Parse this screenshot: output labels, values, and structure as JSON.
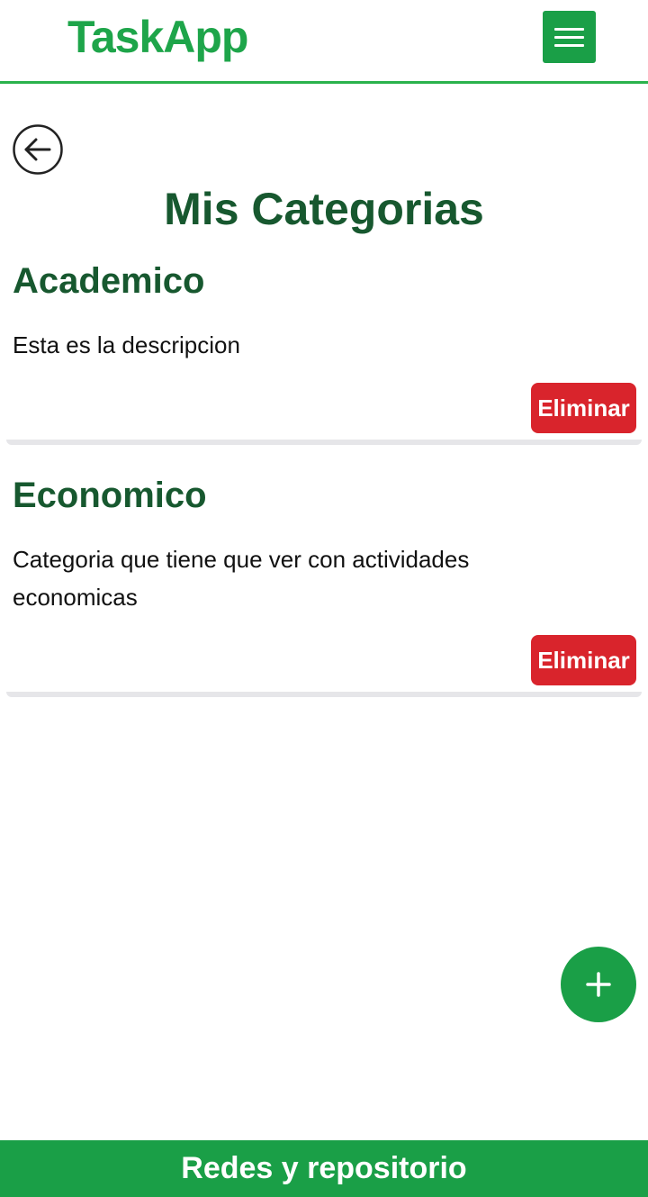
{
  "header": {
    "brand": "TaskApp",
    "menu_icon": "hamburger-menu-icon"
  },
  "navigation": {
    "back_icon": "arrow-left-circle-icon"
  },
  "page": {
    "title": "Mis Categorias"
  },
  "categories": [
    {
      "name": "Academico",
      "description": "Esta es la descripcion",
      "delete_label": "Eliminar"
    },
    {
      "name": "Economico",
      "description": "Categoria que tiene que ver con actividades economicas",
      "delete_label": "Eliminar"
    }
  ],
  "fab": {
    "icon": "plus-icon"
  },
  "footer": {
    "link_label": "Redes y repositorio"
  },
  "colors": {
    "brand_green": "#1ea54a",
    "primary_green": "#1a9f47",
    "title_dark_green": "#17582f",
    "danger_red": "#d9242c"
  }
}
